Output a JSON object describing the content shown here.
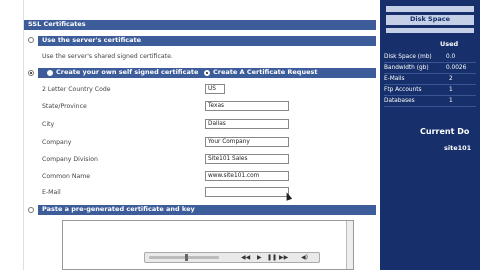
{
  "main": {
    "section_title": "SSL Certificates",
    "option_server_cert": "Use the server's certificate",
    "option_server_cert_desc": "Use the server's shared signed certificate.",
    "option_self_signed": "Create your own self signed certificate",
    "option_request": "Create A Certificate Request",
    "option_paste": "Paste a pre-generated certificate and key",
    "fields": [
      {
        "label": "2 Letter Country Code",
        "value": "US"
      },
      {
        "label": "State/Province",
        "value": "Texas"
      },
      {
        "label": "City",
        "value": "Dallas"
      },
      {
        "label": "Company",
        "value": "Your Company"
      },
      {
        "label": "Company Division",
        "value": "Site101 Sales"
      },
      {
        "label": "Common Name",
        "value": "www.site101.com"
      },
      {
        "label": "E-Mail",
        "value": ""
      }
    ]
  },
  "sidebar": {
    "disk_space_title": "Disk Space",
    "used_header": "Used",
    "rows": [
      {
        "label": "Disk Space (mb)",
        "value": "0.0"
      },
      {
        "label": "Bandwidth (gb)",
        "value": "0.0026"
      },
      {
        "label": "E-Mails",
        "value": "2"
      },
      {
        "label": "Ftp Accounts",
        "value": "1"
      },
      {
        "label": "Databases",
        "value": "1"
      }
    ],
    "current_domain_label": "Current Do",
    "current_domain_value": "site101"
  },
  "player": {
    "icons": [
      "play-icon",
      "rewind-icon",
      "pause-icon",
      "forward-icon",
      "volume-icon"
    ]
  },
  "colors": {
    "header": "#3d5c9a",
    "sidebar": "#17306b",
    "sidebar_header": "#c5d0e6"
  }
}
